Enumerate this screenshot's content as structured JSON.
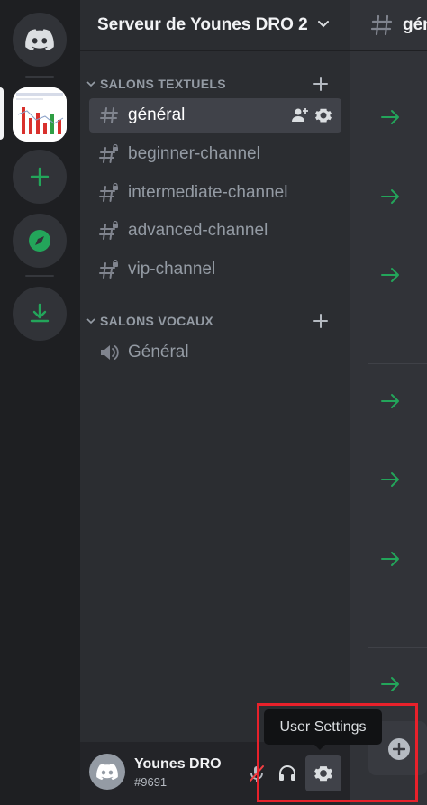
{
  "server": {
    "name": "Serveur de Younes DRO 2"
  },
  "categories": [
    {
      "label": "SALONS TEXTUELS"
    },
    {
      "label": "SALONS VOCAUX"
    }
  ],
  "text_channels": [
    {
      "name": "général",
      "active": true
    },
    {
      "name": "beginner-channel"
    },
    {
      "name": "intermediate-channel"
    },
    {
      "name": "advanced-channel"
    },
    {
      "name": "vip-channel"
    }
  ],
  "voice_channels": [
    {
      "name": "Général"
    }
  ],
  "main": {
    "channel_title": "général"
  },
  "user": {
    "name": "Younes DRO",
    "tag": "#9691"
  },
  "tooltip": {
    "text": "User Settings"
  },
  "colors": {
    "accent_green": "#23a55a",
    "highlight_red": "#e8212b",
    "active_channel_bg": "#404249"
  },
  "icons": {
    "home": "discord-logo-icon",
    "add_server": "plus-icon",
    "explore": "compass-icon",
    "download": "download-icon",
    "mute": "microphone-muted-icon",
    "deafen": "headphones-icon",
    "settings": "gear-icon"
  }
}
